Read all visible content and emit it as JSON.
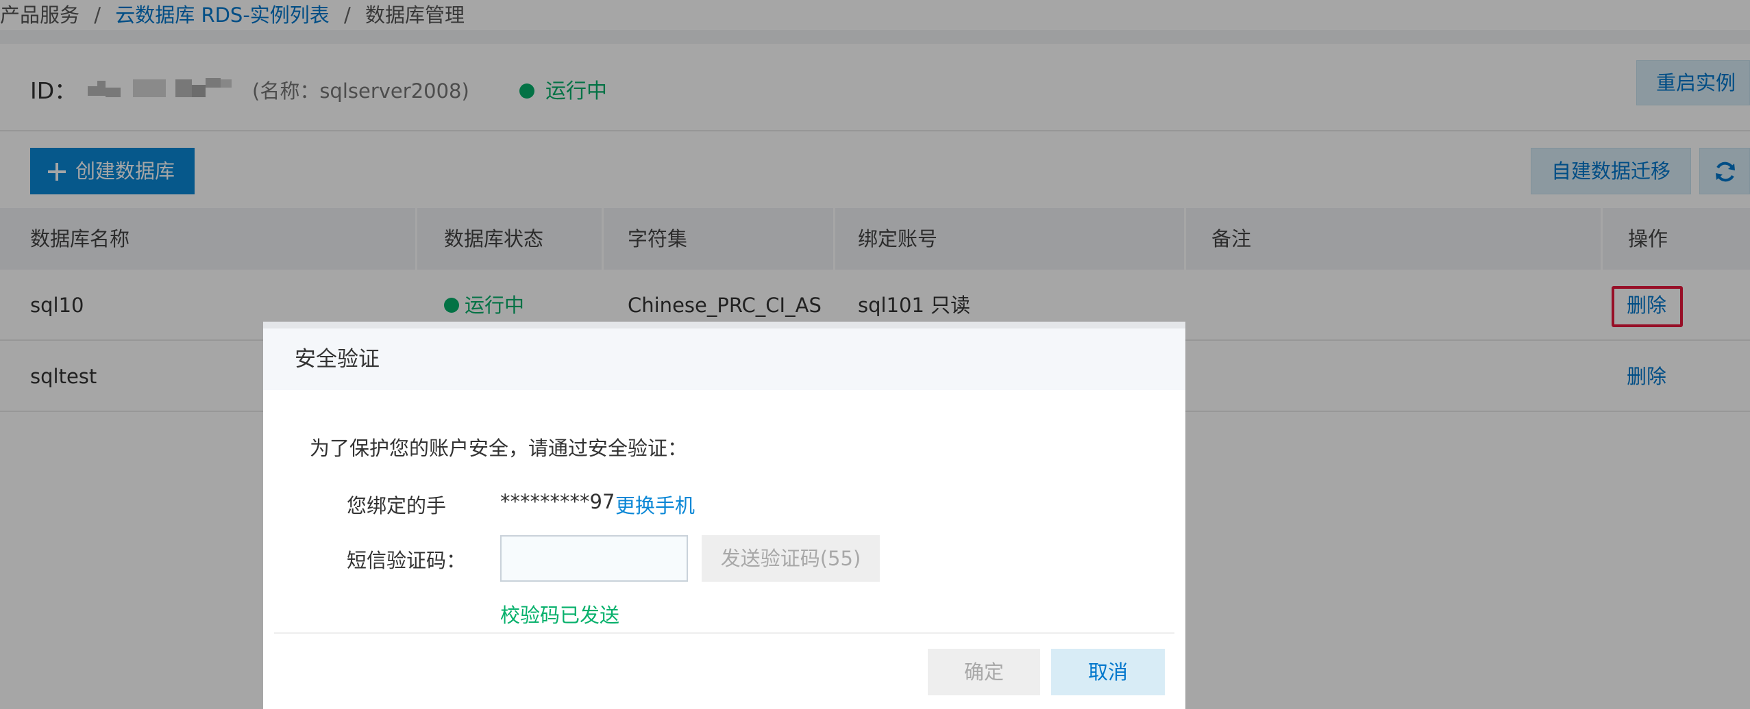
{
  "breadcrumb": {
    "items": [
      "产品服务",
      "云数据库 RDS-实例列表",
      "数据库管理"
    ],
    "separator": "/"
  },
  "instance": {
    "id_label": "ID：",
    "name_text": "(名称：sqlserver2008)",
    "status": "运行中",
    "restart_label": "重启实例"
  },
  "toolbar": {
    "create_label": "创建数据库",
    "migrate_label": "自建数据迁移",
    "refresh_icon": "refresh-icon"
  },
  "table": {
    "headers": [
      "数据库名称",
      "数据库状态",
      "字符集",
      "绑定账号",
      "备注",
      "操作"
    ],
    "rows": [
      {
        "name": "sql10",
        "status": "运行中",
        "charset": "Chinese_PRC_CI_AS",
        "account": "sql101 只读",
        "note": "",
        "action": "删除"
      },
      {
        "name": "sqltest",
        "status": "",
        "charset": "",
        "account": "",
        "note": "",
        "action": "删除"
      }
    ]
  },
  "modal": {
    "title": "安全验证",
    "intro": "为了保护您的账户安全，请通过安全验证：",
    "phone_label": "您绑定的手",
    "phone_value": "*********97",
    "change_phone": "更换手机",
    "sms_label": "短信验证码：",
    "sms_value": "",
    "send_code": "发送验证码(55)",
    "sent_message": "校验码已发送",
    "confirm": "确定",
    "cancel": "取消"
  },
  "colors": {
    "primary": "#0a87d6",
    "link": "#0077cc",
    "success": "#06b06b",
    "highlight": "#e8173d",
    "light_button": "#d8ecf6"
  }
}
